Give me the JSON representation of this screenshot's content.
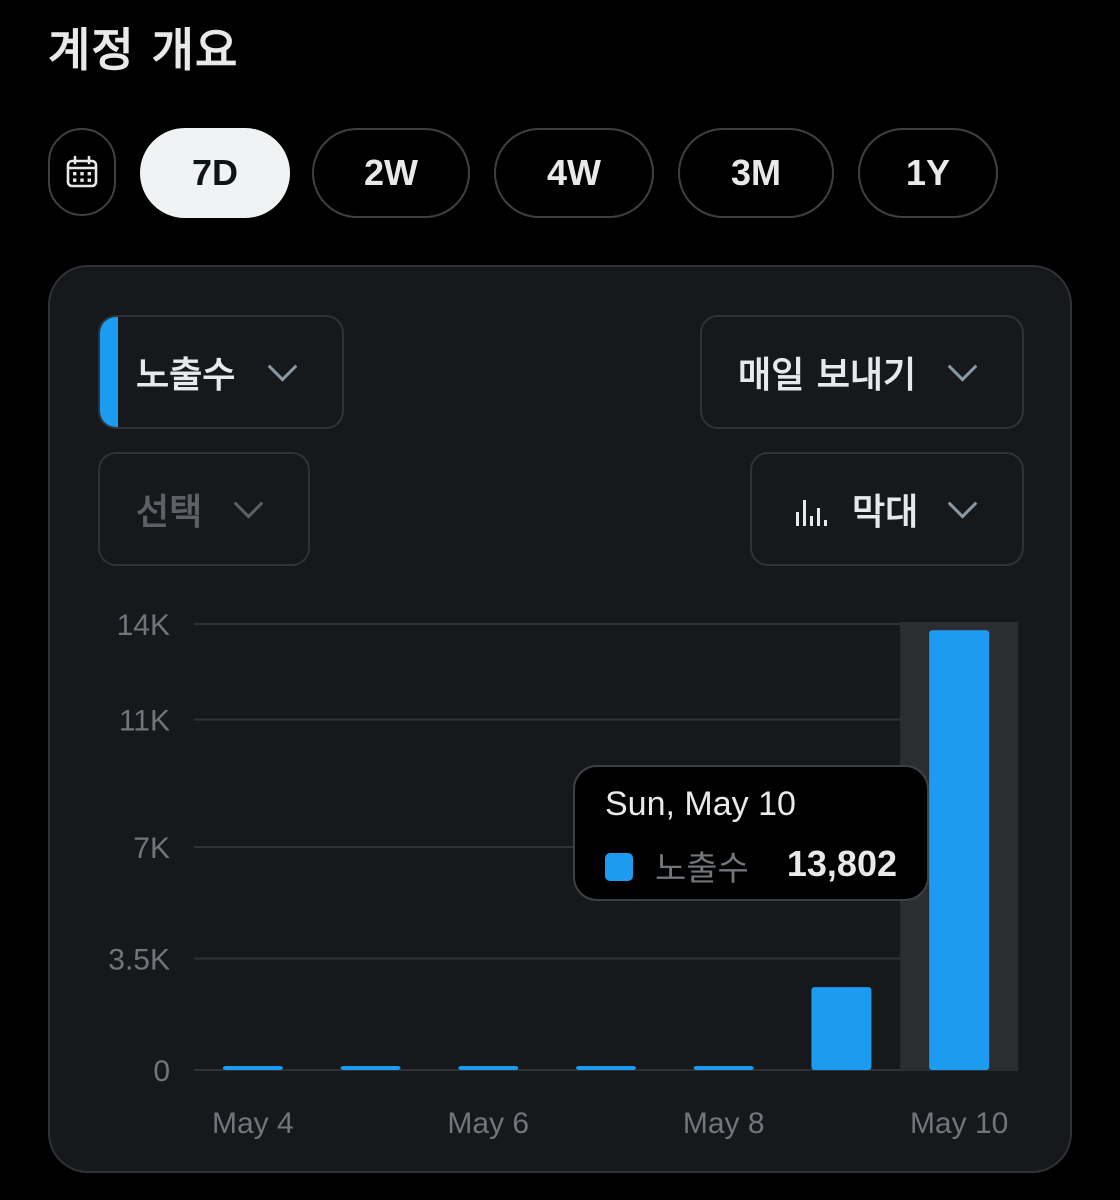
{
  "header": {
    "title": "계정 개요"
  },
  "range": {
    "calendar_icon": "calendar-icon",
    "options": [
      "7D",
      "2W",
      "4W",
      "3M",
      "1Y"
    ],
    "selected": "7D"
  },
  "controls": {
    "metric_label": "노출수",
    "send_label": "매일 보내기",
    "compare_placeholder": "선택",
    "chart_type_label": "막대",
    "chart_type_icon": "bar-chart-icon",
    "chevron_icon": "chevron-down-icon"
  },
  "colors": {
    "accent": "#1d9bf0",
    "background": "#000000",
    "card": "#16181c",
    "highlight": "#2b2d31"
  },
  "tooltip": {
    "date": "Sun, May 10",
    "series": "노출수",
    "value": "13,802"
  },
  "chart_data": {
    "type": "bar",
    "categories": [
      "May 4",
      "May 5",
      "May 6",
      "May 7",
      "May 8",
      "May 9",
      "May 10"
    ],
    "x_tick_labels": [
      "May 4",
      "May 6",
      "May 8",
      "May 10"
    ],
    "series": [
      {
        "name": "노출수",
        "values": [
          0,
          0,
          0,
          0,
          0,
          2600,
          13802
        ]
      }
    ],
    "y_ticks": [
      0,
      3500,
      7000,
      11000,
      14000
    ],
    "y_tick_labels": [
      "0",
      "3.5K",
      "7K",
      "11K",
      "14K"
    ],
    "ylim": [
      0,
      14000
    ],
    "highlighted_category": "May 10",
    "grid": true,
    "legend": "none"
  }
}
